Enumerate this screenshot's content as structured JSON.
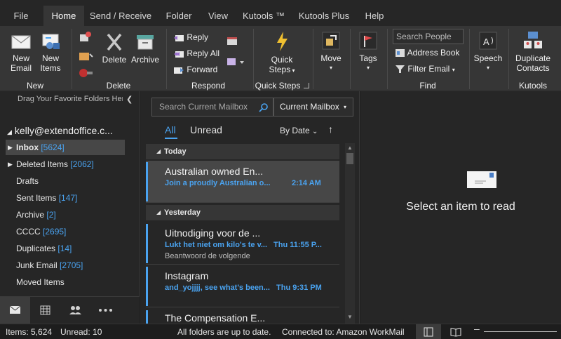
{
  "tabs": [
    {
      "label": "File",
      "active": false
    },
    {
      "label": "Home",
      "active": true
    },
    {
      "label": "Send / Receive",
      "active": false
    },
    {
      "label": "Folder",
      "active": false
    },
    {
      "label": "View",
      "active": false
    },
    {
      "label": "Kutools ™",
      "active": false
    },
    {
      "label": "Kutools Plus",
      "active": false
    },
    {
      "label": "Help",
      "active": false
    }
  ],
  "ribbon": {
    "new_group": {
      "label": "New",
      "new_email": [
        "New",
        "Email"
      ],
      "new_items": [
        "New",
        "Items"
      ]
    },
    "delete_group": {
      "label": "Delete",
      "delete": "Delete",
      "archive": "Archive"
    },
    "respond_group": {
      "label": "Respond",
      "reply": "Reply",
      "reply_all": "Reply All",
      "forward": "Forward"
    },
    "quicksteps_group": {
      "label": "Quick Steps",
      "quick_steps": [
        "Quick",
        "Steps"
      ]
    },
    "move_group": {
      "move": "Move"
    },
    "tags_group": {
      "tags": "Tags"
    },
    "find_group": {
      "label": "Find",
      "search_people_placeholder": "Search People",
      "address_book": "Address Book",
      "filter_email": "Filter Email"
    },
    "speech_group": {
      "speech": "Speech"
    },
    "kutools_group": {
      "label": "Kutools",
      "duplicate_contacts": [
        "Duplicate",
        "Contacts"
      ]
    }
  },
  "folder_pane": {
    "drag_hint": "Drag Your Favorite Folders Here",
    "account": "kelly@extendoffice.c...",
    "folders": [
      {
        "name": "Inbox",
        "count": "[5624]",
        "selected": true,
        "expandable": true
      },
      {
        "name": "Deleted Items",
        "count": "[2062]",
        "selected": false,
        "expandable": true
      },
      {
        "name": "Drafts",
        "count": "",
        "selected": false,
        "expandable": false
      },
      {
        "name": "Sent Items",
        "count": "[147]",
        "selected": false,
        "expandable": false
      },
      {
        "name": "Archive",
        "count": "[2]",
        "selected": false,
        "expandable": false
      },
      {
        "name": "CCCC",
        "count": "[2695]",
        "selected": false,
        "expandable": false
      },
      {
        "name": "Duplicates",
        "count": "[14]",
        "selected": false,
        "expandable": false
      },
      {
        "name": "Junk Email",
        "count": "[2705]",
        "selected": false,
        "expandable": false
      },
      {
        "name": "Moved Items",
        "count": "",
        "selected": false,
        "expandable": false
      }
    ],
    "nav": [
      "mail-icon",
      "calendar-icon",
      "people-icon",
      "more-icon"
    ]
  },
  "mail_list": {
    "search_placeholder": "Search Current Mailbox",
    "scope": "Current Mailbox",
    "filter_all": "All",
    "filter_unread": "Unread",
    "sort": "By Date",
    "groups": [
      {
        "label": "Today",
        "mails": [
          {
            "sender": "Australian owned En...",
            "subject": "Join a proudly Australian o...",
            "time": "2:14 AM",
            "preview": "",
            "selected": true
          }
        ]
      },
      {
        "label": "Yesterday",
        "mails": [
          {
            "sender": "Uitnodiging voor de ...",
            "subject": "Lukt het niet om kilo's te v...",
            "time": "Thu 11:55 P...",
            "preview": "Beantwoord de volgende",
            "selected": false
          },
          {
            "sender": "Instagram",
            "subject": "and_yojjjj, see what's been...",
            "time": "Thu 9:31 PM",
            "preview": "",
            "selected": false
          },
          {
            "sender": "The Compensation E...",
            "subject": "",
            "time": "",
            "preview": "",
            "selected": false
          }
        ]
      }
    ]
  },
  "reading_pane": {
    "message": "Select an item to read"
  },
  "status_bar": {
    "items": "Items: 5,624",
    "unread": "Unread: 10",
    "sync": "All folders are up to date.",
    "connection": "Connected to: Amazon WorkMail"
  },
  "colors": {
    "accent": "#4aa3f0",
    "background": "#262626",
    "ribbon": "#363636"
  }
}
